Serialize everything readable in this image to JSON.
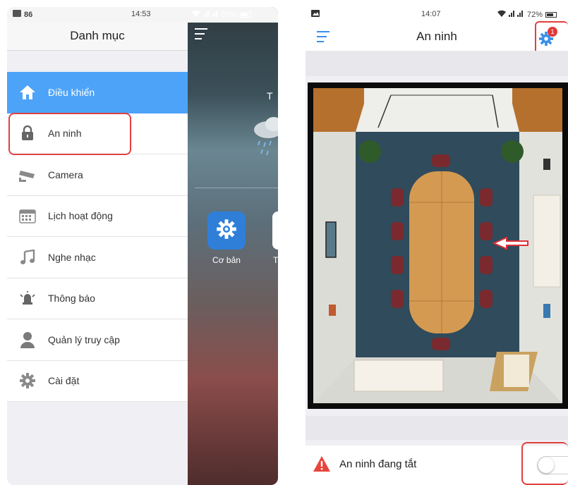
{
  "left_screen": {
    "status_bar": {
      "notification": "86",
      "time": "14:53",
      "battery": "59%"
    },
    "drawer": {
      "title": "Danh mục",
      "items": [
        {
          "label": "Điều khiển",
          "icon": "home-icon",
          "active": true
        },
        {
          "label": "An ninh",
          "icon": "lock-icon",
          "highlighted": true
        },
        {
          "label": "Camera",
          "icon": "cctv-camera-icon"
        },
        {
          "label": "Lịch hoạt động",
          "icon": "calendar-icon"
        },
        {
          "label": "Nghe nhạc",
          "icon": "music-note-icon"
        },
        {
          "label": "Thông báo",
          "icon": "alarm-bell-icon"
        },
        {
          "label": "Quản lý truy cập",
          "icon": "user-icon"
        },
        {
          "label": "Cài đặt",
          "icon": "gear-icon"
        }
      ]
    },
    "background": {
      "weather_text": "T",
      "tiles": [
        {
          "label": "Cơ bản",
          "icon": "gear-icon"
        },
        {
          "label": "Ti"
        }
      ]
    }
  },
  "right_screen": {
    "status_bar": {
      "time": "14:07",
      "battery": "72%"
    },
    "nav": {
      "title": "An ninh",
      "settings_badge": "1"
    },
    "security_status": {
      "label": "An ninh đang tắt",
      "enabled": false
    },
    "colors": {
      "accent": "#4da3f8",
      "highlight": "#e04040",
      "warning": "#e8453c"
    }
  }
}
